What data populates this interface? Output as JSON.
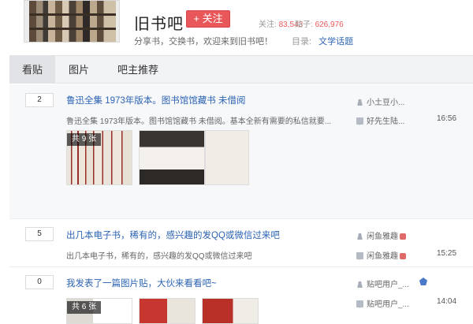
{
  "header": {
    "forum_name": "旧书吧",
    "follow_label": "+ 关注",
    "follow_count_label": "关注:",
    "follow_count": "83,543",
    "post_count_label": "贴子:",
    "post_count": "626,976",
    "slogan": "分享书，交换书，欢迎来到旧书吧！",
    "directory_label": "目录:",
    "directory_link": "文学话题"
  },
  "tabs": [
    {
      "label": "看贴"
    },
    {
      "label": "图片"
    },
    {
      "label": "吧主推荐"
    }
  ],
  "threads": [
    {
      "reply_count": "2",
      "title": "鲁迅全集 1973年版本。图书馆馆藏书 未借阅",
      "abstract": "鲁迅全集 1973年版本。图书馆馆藏书 未借阅。基本全新有需要的私信就要...",
      "author": "小土豆小...",
      "last_replier": "好先生陆...",
      "time": "16:56",
      "image_count_label": "共 9 张"
    },
    {
      "reply_count": "5",
      "title": "出几本电子书，稀有的，感兴趣的发QQ或微信过来吧",
      "abstract": "出几本电子书，稀有的，感兴趣的发QQ或微信过来吧",
      "author": "闲鱼雅趣",
      "last_replier": "闲鱼雅趣",
      "time": "15:25"
    },
    {
      "reply_count": "0",
      "title": "我发表了一篇图片贴，大伙来看看吧~",
      "author": "贴吧用户_...",
      "last_replier": "贴吧用户_...",
      "time": "14:04",
      "image_count_label": "共 6 张"
    }
  ]
}
